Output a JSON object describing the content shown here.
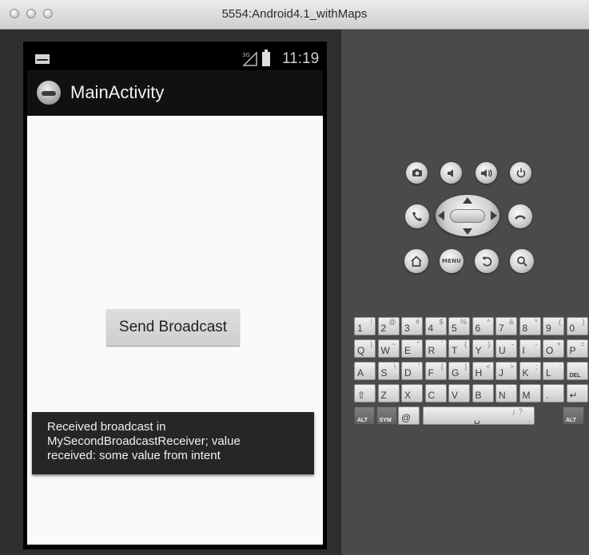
{
  "window": {
    "title": "5554:Android4.1_withMaps"
  },
  "status_bar": {
    "time": "11:19",
    "network": "3G"
  },
  "action_bar": {
    "title": "MainActivity"
  },
  "main": {
    "send_button_label": "Send Broadcast"
  },
  "toast": {
    "lines": [
      "Received broadcast in",
      "MySecondBroadcastReceiver; value",
      "received: some value from intent"
    ]
  },
  "controls": {
    "camera": "camera-icon",
    "volume_down": "volume-down-icon",
    "volume_up": "volume-up-icon",
    "power": "power-icon",
    "call": "call-icon",
    "end_call": "end-call-icon",
    "home": "home-icon",
    "menu": "MENU",
    "back": "back-icon",
    "search": "search-icon"
  },
  "keyboard": {
    "rows": [
      {
        "keys": [
          {
            "main": "1",
            "sub": "!"
          },
          {
            "main": "2",
            "sub": "@"
          },
          {
            "main": "3",
            "sub": "#"
          },
          {
            "main": "4",
            "sub": "$"
          },
          {
            "main": "5",
            "sub": "%"
          },
          {
            "main": "6",
            "sub": "^"
          },
          {
            "main": "7",
            "sub": "&"
          },
          {
            "main": "8",
            "sub": "*"
          },
          {
            "main": "9",
            "sub": "("
          },
          {
            "main": "0",
            "sub": ")"
          }
        ]
      },
      {
        "keys": [
          {
            "main": "Q",
            "sub": "|"
          },
          {
            "main": "W",
            "sub": "~"
          },
          {
            "main": "E",
            "sub": "\""
          },
          {
            "main": "R",
            "sub": "`"
          },
          {
            "main": "T",
            "sub": "{"
          },
          {
            "main": "Y",
            "sub": "}"
          },
          {
            "main": "U",
            "sub": "-"
          },
          {
            "main": "I",
            "sub": "-"
          },
          {
            "main": "O",
            "sub": "+"
          },
          {
            "main": "P",
            "sub": "="
          }
        ]
      },
      {
        "keys": [
          {
            "main": "A",
            "sub": ""
          },
          {
            "main": "S",
            "sub": "\\"
          },
          {
            "main": "D",
            "sub": "'"
          },
          {
            "main": "F",
            "sub": "["
          },
          {
            "main": "G",
            "sub": "]"
          },
          {
            "main": "H",
            "sub": "<"
          },
          {
            "main": "J",
            "sub": ">"
          },
          {
            "main": "K",
            "sub": ";"
          },
          {
            "main": "L",
            "sub": ":"
          },
          {
            "main": "DEL",
            "sub": ""
          }
        ]
      },
      {
        "keys": [
          {
            "main": "⇧",
            "sub": ""
          },
          {
            "main": "Z",
            "sub": ""
          },
          {
            "main": "X",
            "sub": ""
          },
          {
            "main": "C",
            "sub": ""
          },
          {
            "main": "V",
            "sub": ""
          },
          {
            "main": "B",
            "sub": ""
          },
          {
            "main": "N",
            "sub": ""
          },
          {
            "main": "M",
            "sub": ""
          },
          {
            "main": ".",
            "sub": ""
          },
          {
            "main": "↵",
            "sub": ""
          }
        ]
      },
      {
        "keys": [
          {
            "main": "ALT",
            "sub": ""
          },
          {
            "main": "SYM",
            "sub": ""
          },
          {
            "main": "@",
            "sub": ""
          },
          {
            "main": "␣",
            "sub": ""
          },
          {
            "main": "/",
            "sub": "?"
          },
          {
            "main": ",",
            "sub": ""
          },
          {
            "main": "ALT",
            "sub": ""
          }
        ]
      }
    ]
  }
}
